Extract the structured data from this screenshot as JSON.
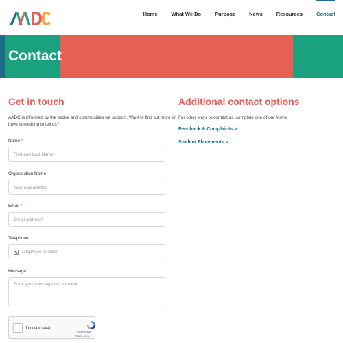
{
  "brand": {
    "logo_alt": "AADC",
    "colors": {
      "teal_blue": "#1d6b89",
      "green": "#1aa17e",
      "red": "#e85f55",
      "orange": "#f2a53a"
    }
  },
  "nav": {
    "items": [
      {
        "label": "Home"
      },
      {
        "label": "What We Do"
      },
      {
        "label": "Purpose"
      },
      {
        "label": "News"
      },
      {
        "label": "Resources"
      },
      {
        "label": "Contact"
      }
    ],
    "active": "Contact"
  },
  "banner": {
    "title": "Contact"
  },
  "get_in_touch": {
    "heading": "Get in touch",
    "intro": "AADC is informed by the sector and communities we support. Want to find out more or have something to tell us?",
    "fields": {
      "name": {
        "label": "Name",
        "required_mark": "*",
        "placeholder": "First and Last Name*"
      },
      "organisation": {
        "label": "Organisation Name",
        "placeholder": "Your organisation"
      },
      "email": {
        "label": "Email",
        "required_mark": "*",
        "placeholder": "Email address*"
      },
      "telephone": {
        "label": "Telephone",
        "placeholder": "Telephone number",
        "icon": "phone-icon"
      },
      "message": {
        "label": "Message",
        "placeholder": "Enter your message or comment"
      }
    },
    "captcha": {
      "label": "I'm not a robot",
      "brand": "reCAPTCHA",
      "links": "Privacy - Terms"
    }
  },
  "additional": {
    "heading": "Additional contact options",
    "subtext": "For other ways to contact us, complete one of our forms",
    "links": [
      {
        "label": "Feedback & Complaints >"
      },
      {
        "label": "Student Placements >"
      }
    ]
  }
}
